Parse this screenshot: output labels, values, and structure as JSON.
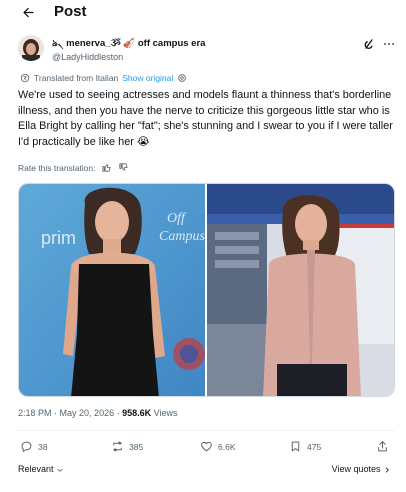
{
  "header": {
    "title": "Post"
  },
  "author": {
    "display_name": "ঌ৲ menerva_ૐ 🎻 off campus era",
    "handle": "@LadyHiddleston"
  },
  "translation": {
    "label": "Translated from Italian",
    "show_original": "Show original"
  },
  "tweet": {
    "text": "We're used to seeing actresses and models flaunt a thinness that's borderline illness, and then you have the nerve to criticize this gorgeous little star who is Ella Bright by calling her \"fat\"; she's stunning and I swear to you if I were taller I'd practically be like her 😭"
  },
  "rate": {
    "label": "Rate this translation:"
  },
  "meta": {
    "time": "2:18 PM",
    "date": "May 20, 2026",
    "views_count": "958.6K",
    "views_label": "Views"
  },
  "actions": {
    "replies": "38",
    "reposts": "385",
    "likes": "6.6K",
    "bookmarks": "475"
  },
  "footer": {
    "sort_label": "Relevant",
    "view_quotes": "View quotes"
  },
  "colors": {
    "link": "#1d9bf0",
    "secondary_text": "#536471",
    "primary_text": "#0f1419"
  },
  "icons": [
    "back-arrow-icon",
    "grok-icon",
    "more-icon",
    "translate-icon",
    "thumbs-up-icon",
    "thumbs-down-icon",
    "reply-icon",
    "repost-icon",
    "like-icon",
    "bookmark-icon",
    "share-icon",
    "chevron-down-icon"
  ]
}
